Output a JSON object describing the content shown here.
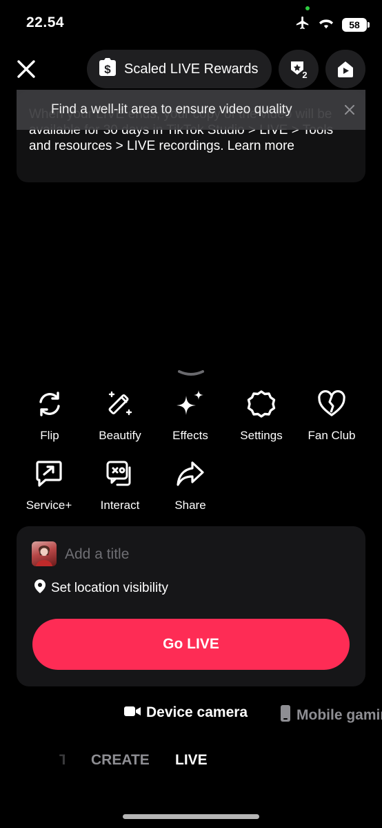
{
  "status_bar": {
    "time": "22.54",
    "battery": "58"
  },
  "header": {
    "rewards_label": "Scaled LIVE Rewards",
    "badge_count": "2"
  },
  "notice": {
    "text": "When your LIVE ends, your copy of the video will be available for 30 days in TikTok Studio > LIVE > Tools and resources > LIVE recordings.",
    "link": "Learn more"
  },
  "toast": {
    "text": "Find a well-lit area to ensure video quality"
  },
  "tools": [
    {
      "label": "Flip",
      "icon": "flip-icon"
    },
    {
      "label": "Beautify",
      "icon": "magic-wand-icon"
    },
    {
      "label": "Effects",
      "icon": "sparkles-icon"
    },
    {
      "label": "Settings",
      "icon": "gear-icon"
    },
    {
      "label": "Fan Club",
      "icon": "heart-icon"
    },
    {
      "label": "Service+",
      "icon": "service-plus-icon"
    },
    {
      "label": "Interact",
      "icon": "game-chat-icon"
    },
    {
      "label": "Share",
      "icon": "share-arrow-icon"
    }
  ],
  "composer": {
    "title_placeholder": "Add a title",
    "location_label": "Set location visibility",
    "go_live_label": "Go LIVE"
  },
  "sources": [
    {
      "label": "Device camera",
      "icon": "video-camera-icon",
      "active": true
    },
    {
      "label": "Mobile gaming",
      "icon": "phone-icon",
      "active": false
    }
  ],
  "modes": [
    {
      "label": "CREATE",
      "active": false
    },
    {
      "label": "LIVE",
      "active": true
    }
  ],
  "colors": {
    "accent": "#fe2c55",
    "card": "#161618",
    "pill": "#1f1f21",
    "muted": "#8e8e93"
  }
}
